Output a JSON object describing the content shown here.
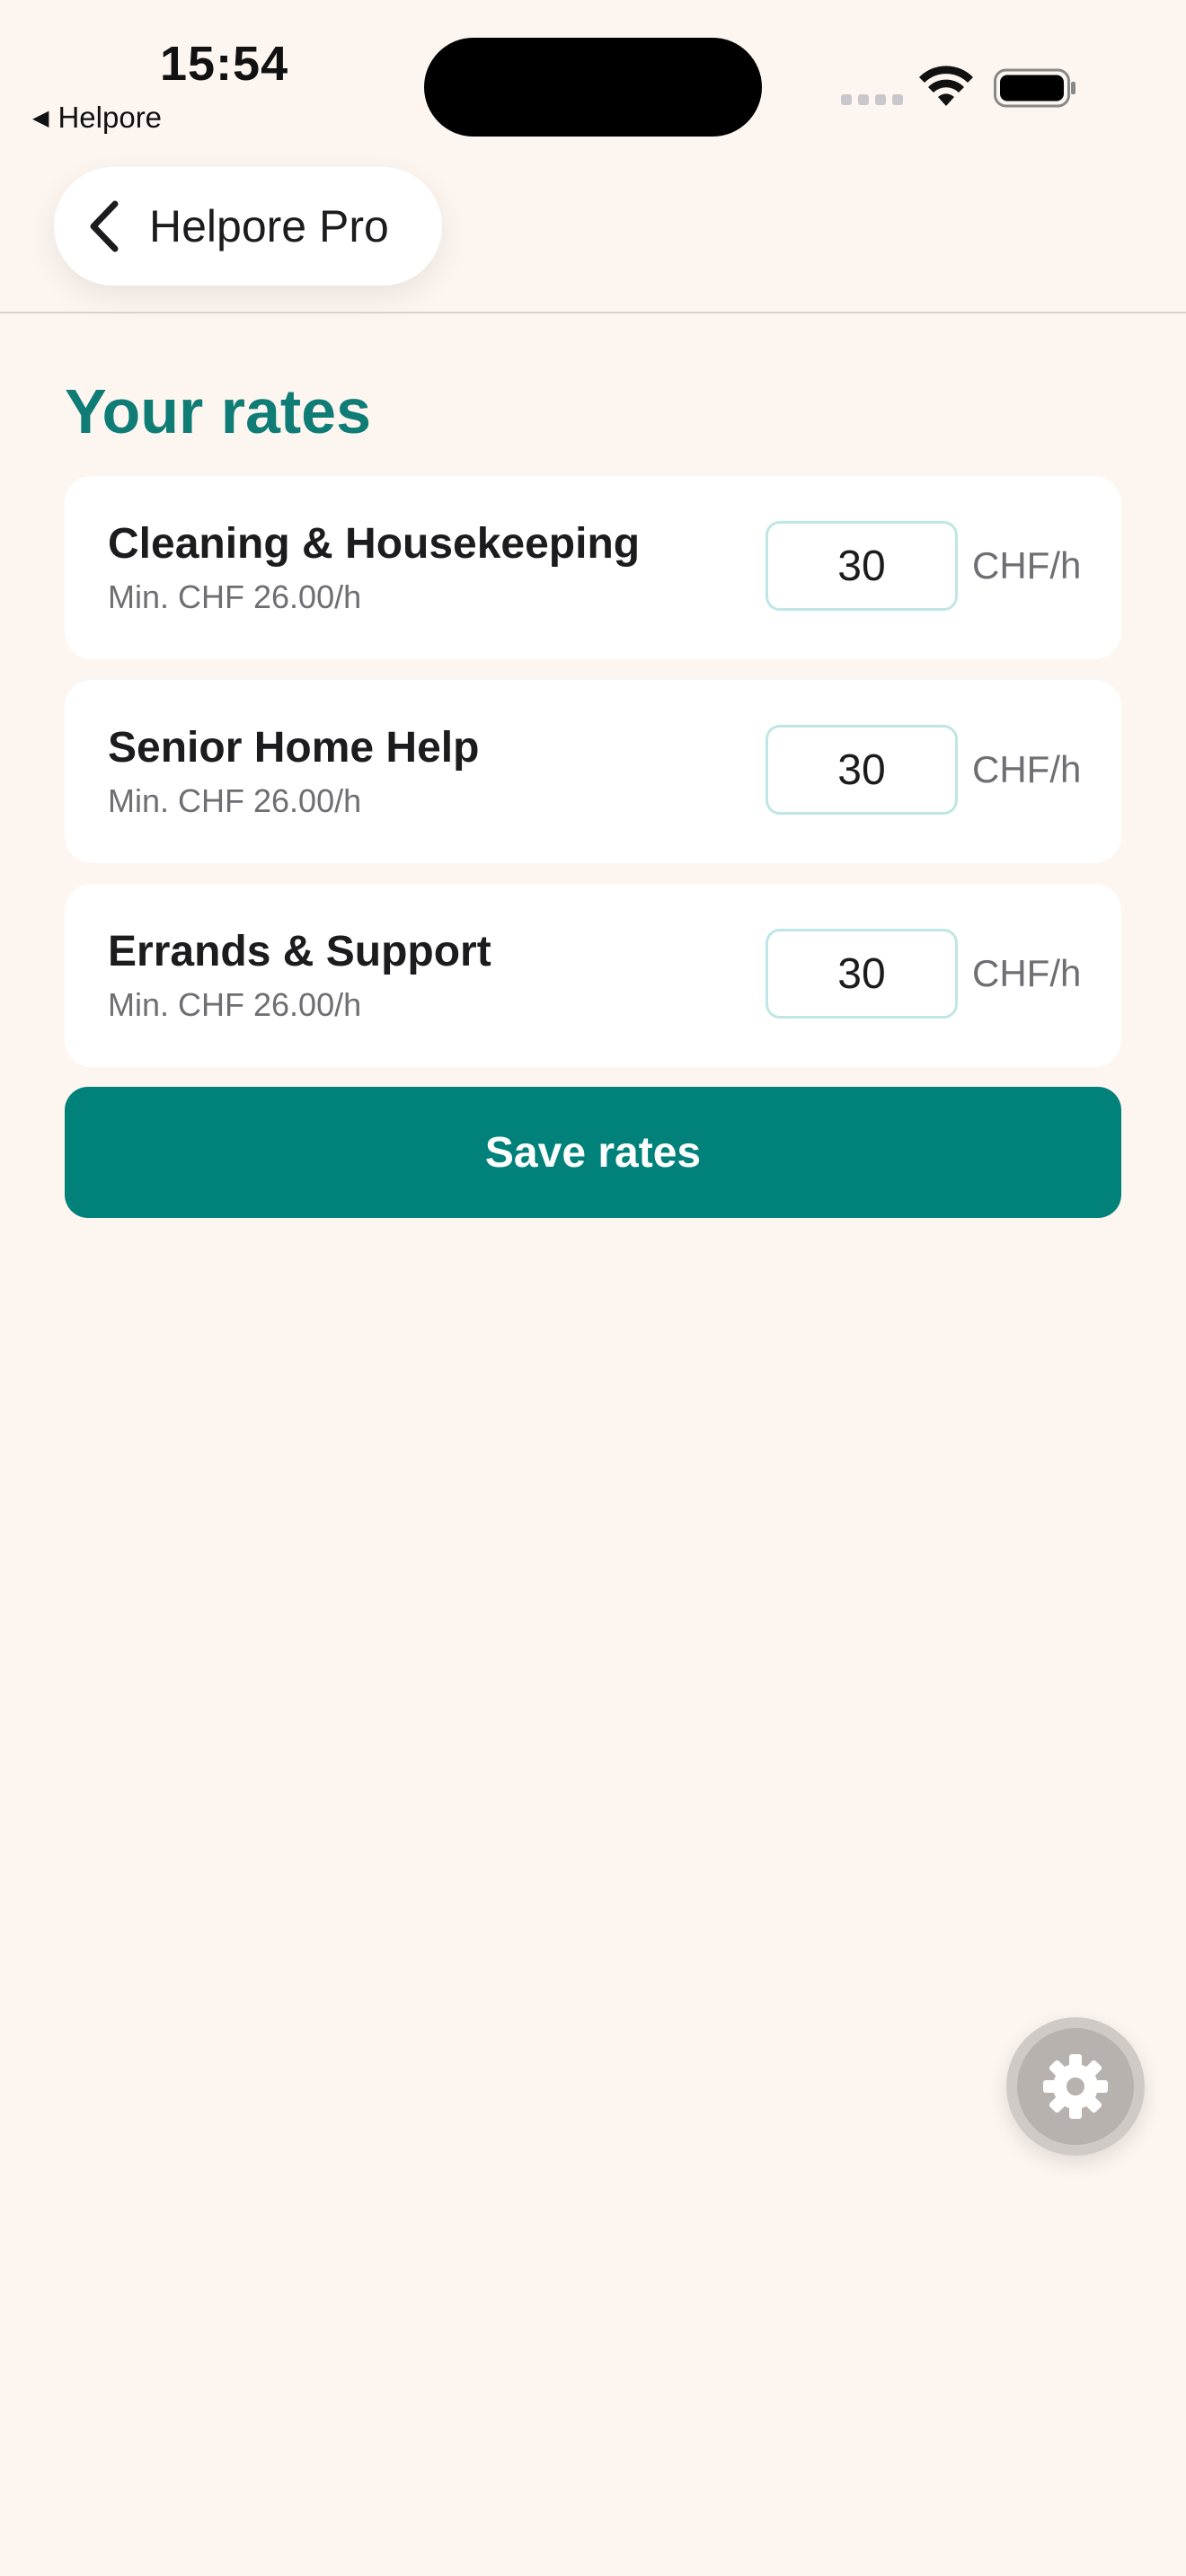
{
  "status_bar": {
    "time": "15:54",
    "back_app": "Helpore"
  },
  "nav": {
    "title": "Helpore Pro"
  },
  "page": {
    "title": "Your rates"
  },
  "rates": [
    {
      "name": "Cleaning & Housekeeping",
      "min": "Min. CHF 26.00/h",
      "value": "30",
      "unit": "CHF/h"
    },
    {
      "name": "Senior Home Help",
      "min": "Min. CHF 26.00/h",
      "value": "30",
      "unit": "CHF/h"
    },
    {
      "name": "Errands & Support",
      "min": "Min. CHF 26.00/h",
      "value": "30",
      "unit": "CHF/h"
    }
  ],
  "actions": {
    "save_label": "Save rates"
  },
  "colors": {
    "accent": "#00817a",
    "title": "#0f7c76",
    "background": "#fdf6f0"
  }
}
